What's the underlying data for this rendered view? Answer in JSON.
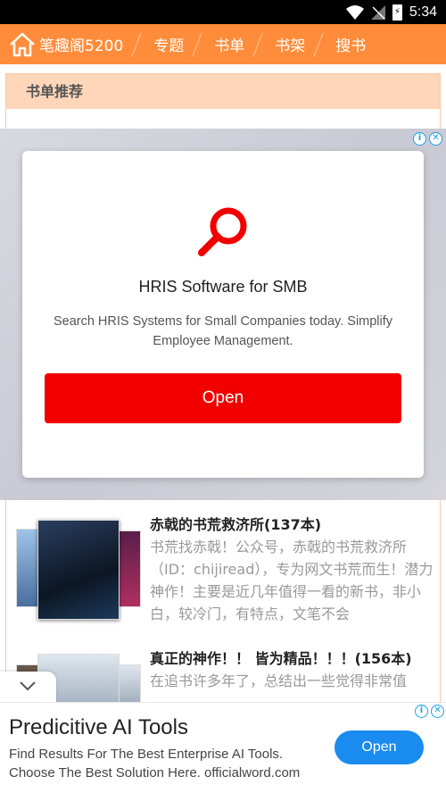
{
  "status_bar": {
    "time": "5:34"
  },
  "nav": {
    "brand": "笔趣阁5200",
    "items": [
      "专题",
      "书单",
      "书架",
      "搜书"
    ]
  },
  "section": {
    "title": "书单推荐"
  },
  "interstitial_ad": {
    "title": "HRIS Software for SMB",
    "description": "Search HRIS Systems for Small Companies today. Simplify Employee Management.",
    "button": "Open"
  },
  "books": [
    {
      "title": "赤戟的书荒救济所(137本)",
      "description": "书荒找赤戟！公众号，赤戟的书荒救济所（ID：chijiread），专为网文书荒而生！潜力神作！主要是近几年值得一看的新书，非小白，较冷门，有特点，文笔不会"
    },
    {
      "title": "真正的神作！！ 皆为精品！！！(156本)",
      "description": "在追书许多年了，总结出一些觉得非常值"
    }
  ],
  "bottom_banner": {
    "title": "Predicitive AI Tools",
    "description": "Find Results For The Best Enterprise AI Tools. Choose The Best Solution Here. officialword.com",
    "button": "Open"
  },
  "colors": {
    "nav": "#ff8c3a",
    "ad_button": "#f20000",
    "banner_button": "#1a8cf0"
  }
}
